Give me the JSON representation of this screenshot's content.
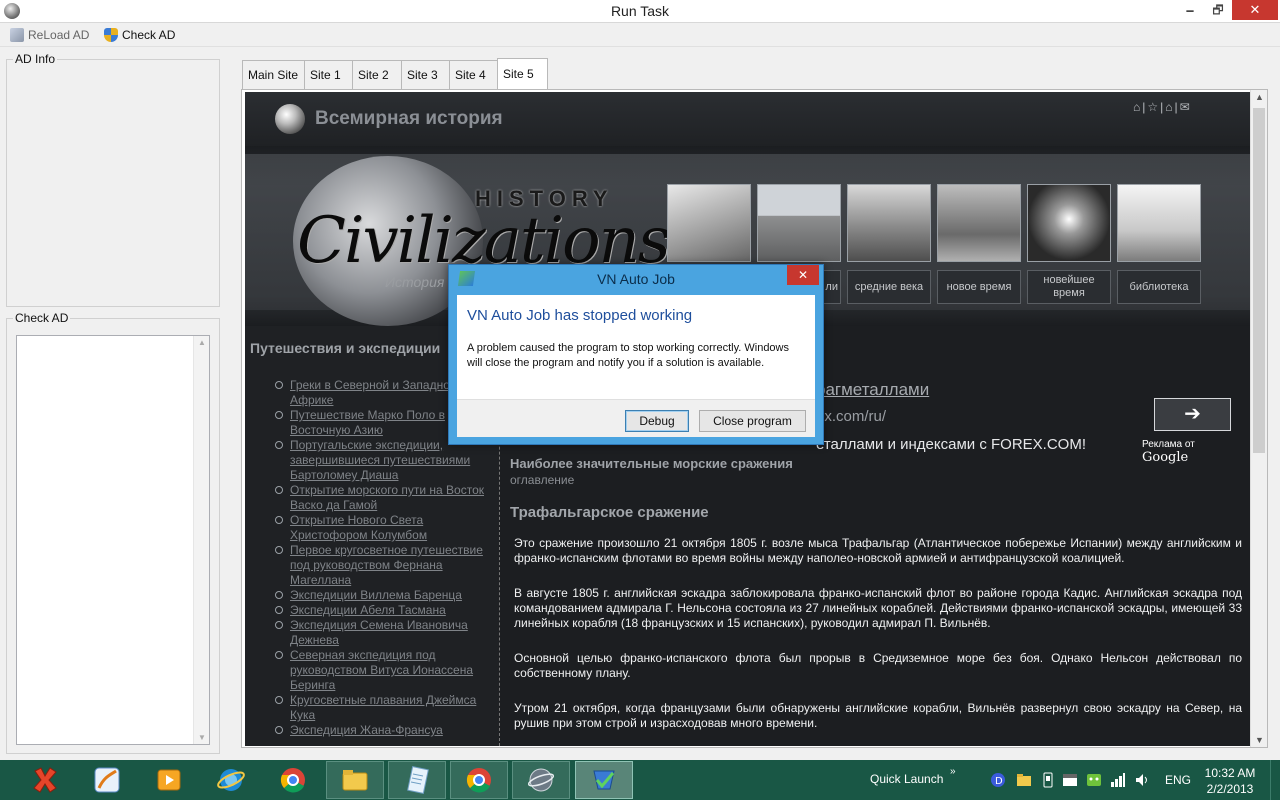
{
  "window": {
    "title": "Run Task",
    "min": "🗕",
    "max": "🗗",
    "close": "✕"
  },
  "toolbar": {
    "reload_label": "ReLoad AD",
    "check_label": "Check AD"
  },
  "panels": {
    "ad_info": "AD Info",
    "check_ad": "Check AD"
  },
  "tabs": [
    {
      "label": "Main Site"
    },
    {
      "label": "Site 1"
    },
    {
      "label": "Site 2"
    },
    {
      "label": "Site 3"
    },
    {
      "label": "Site 4"
    },
    {
      "label": "Site 5"
    }
  ],
  "site": {
    "title": "Всемирная история",
    "header_icons": "⌂|☆|⌂|✉",
    "logo_word": "Civilizations",
    "logo_history": "HISTORY",
    "logo_sub": "История",
    "categories": [
      {
        "label": "ли"
      },
      {
        "label": "средние века"
      },
      {
        "label": "новое время"
      },
      {
        "label": "новейшее время"
      },
      {
        "label": "библиотека"
      }
    ],
    "sidebar": {
      "title": "Путешествия и экспедиции",
      "items": [
        "Греки в Северной и Западной Африке",
        "Путешествие Марко Поло в Восточную Азию",
        "Португальские экспедиции, завершившиеся путешествиями Бартоломеу Диаша",
        "Открытие морского пути на Восток Васко да Гамой",
        "Открытие Нового Света Христофором Колумбом",
        "Первое кругосветное путешествие под руководством Фернана Магеллана",
        "Экспедиции Виллема Баренца",
        "Экспедиции Абеля Тасмана",
        "Экспедиция Семена Ивановича Дежнева",
        "Северная экспедиция под руководством Витуса Ионассена Беринга",
        "Кругосветные плавания Джеймса Кука",
        "Экспедиция Жана-Франсуа"
      ]
    },
    "ad": {
      "link": "рагметаллами",
      "url": "ex.com/ru/",
      "text": "еталлами и индексами с FOREX.COM!",
      "arrow": "➔",
      "by_prefix": "Реклама от ",
      "by_brand": "Google"
    },
    "content": {
      "heading": "Наиболее значительные морские сражения",
      "toc": "оглавление",
      "section": "Трафальгарское сражение",
      "paragraphs": [
        "Это сражение произошло 21 октября 1805 г. возле мыса Трафальгар (Атлантическое побережье Испании) между английским и франко-испанским флотами во время войны между наполео-новской армией и антифранцузской коалицией.",
        "В августе 1805 г. английская эскадра заблокировала франко-испанский флот во районе города Кадис. Английская эскадра под командованием адмирала Г. Нельсона состояла из 27 линейных кораблей. Действиями франко-испанской эскадры, имеющей 33 линейных корабля (18 французских и 15 испанских), руководил адмирал П. Вильнёв.",
        "Основной целью франко-испанского флота был прорыв в Средиземное море без боя. Однако Нельсон действовал по собственному плану.",
        "Утром 21 октября, когда французами были обнаружены английские корабли, Вильнёв развернул свою эскадру на Север, на рушив при этом строй и израсходовав много времени."
      ]
    }
  },
  "dialog": {
    "title": "VN Auto Job",
    "close": "✕",
    "heading": "VN Auto Job has stopped working",
    "message": "A problem caused the program to stop working correctly. Windows will close the program and notify you if a solution is available.",
    "debug_label": "Debug",
    "close_label": "Close program"
  },
  "taskbar": {
    "quick_launch": "Quick Launch",
    "chevron": "»",
    "lang": "ENG",
    "time": "10:32 AM",
    "date": "2/2/2013"
  },
  "colors": {
    "accent": "#4aa4e0",
    "close_red": "#c7372f",
    "taskbar": "#195745",
    "site_bg": "#1c1e21"
  }
}
